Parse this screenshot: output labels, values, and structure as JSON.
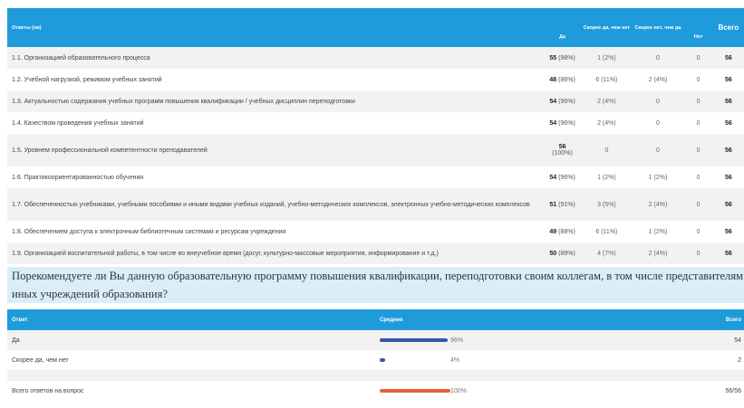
{
  "table": {
    "headers": {
      "question": "Ответы (ов)",
      "yes": "Да",
      "rather_yes": "Скорее да, чем нет",
      "rather_no": "Скорее нет, чем да",
      "no": "Нет",
      "total": "Всего"
    },
    "rows": [
      {
        "q": "1.1. Организацией образовательного процесса",
        "yes_n": "55",
        "yes_p": "(98%)",
        "rather_yes": "1 (2%)",
        "rather_no": "0",
        "no": "0",
        "total": "56"
      },
      {
        "q": "1.2. Учебной нагрузкой, режимом учебных занятий",
        "yes_n": "48",
        "yes_p": "(86%)",
        "rather_yes": "6 (11%)",
        "rather_no": "2 (4%)",
        "no": "0",
        "total": "56"
      },
      {
        "q": "1.3. Актуальностью содержания учебных программ повышения квалификации / учебных дисциплин переподготовки",
        "yes_n": "54",
        "yes_p": "(96%)",
        "rather_yes": "2 (4%)",
        "rather_no": "0",
        "no": "0",
        "total": "56"
      },
      {
        "q": "1.4. Качеством проведения учебных занятий",
        "yes_n": "54",
        "yes_p": "(96%)",
        "rather_yes": "2 (4%)",
        "rather_no": "0",
        "no": "0",
        "total": "56"
      },
      {
        "q": "1.5. Уровнем профессиональной компетентности преподавателей",
        "yes_n": "56",
        "yes_p": "(100%)",
        "rather_yes": "0",
        "rather_no": "0",
        "no": "0",
        "total": "56"
      },
      {
        "q": "1.6. Практикоориентированностью обучения",
        "yes_n": "54",
        "yes_p": "(96%)",
        "rather_yes": "1 (2%)",
        "rather_no": "1 (2%)",
        "no": "0",
        "total": "56"
      },
      {
        "q": "1.7. Обеспеченностью учебниками, учебными пособиями и иными видами учебных изданий, учебно-методических комплексов, электронных учебно-методических комплексов",
        "yes_n": "51",
        "yes_p": "(91%)",
        "rather_yes": "3 (5%)",
        "rather_no": "2 (4%)",
        "no": "0",
        "total": "56"
      },
      {
        "q": "1.8. Обеспечением доступа к электронным библиотечным системам и ресурсам учреждения",
        "yes_n": "49",
        "yes_p": "(88%)",
        "rather_yes": "6 (11%)",
        "rather_no": "1 (2%)",
        "no": "0",
        "total": "56"
      },
      {
        "q": "1.9. Организацией воспитательной работы, в том числе во внеучебное время (досуг, культурно-массовые мероприятия, информирование и т.д.)",
        "yes_n": "50",
        "yes_p": "(89%)",
        "rather_yes": "4 (7%)",
        "rather_no": "2 (4%)",
        "no": "0",
        "total": "56"
      }
    ]
  },
  "question": "Порекомендуете ли Вы данную образовательную программу повышения квалификации, переподготовки своим коллегам, в том числе представителям иных учреждений образования?",
  "avg_table": {
    "headers": {
      "answer": "Ответ",
      "average": "Среднее",
      "total": "Всего"
    },
    "rows": [
      {
        "answer": "Да",
        "percent_label": "96%",
        "fraction": 0.96,
        "color": "#3a54a8",
        "total": "54"
      },
      {
        "answer": "Скорее да, чем нет",
        "percent_label": "4%",
        "fraction": 0.04,
        "color": "#3a54a8",
        "total": "2"
      },
      {
        "answer": "",
        "percent_label": "",
        "fraction": 0,
        "color": "#3a54a8",
        "total": ""
      },
      {
        "answer": "Всего ответов на вопрос",
        "percent_label": "100%",
        "fraction": 1.0,
        "color": "#e8632e",
        "total": "56/56"
      }
    ]
  },
  "colors": {
    "header_blue": "#1f9bdb",
    "question_bg": "#d9eef8",
    "bar_blue": "#3a54a8",
    "bar_orange": "#e8632e"
  }
}
